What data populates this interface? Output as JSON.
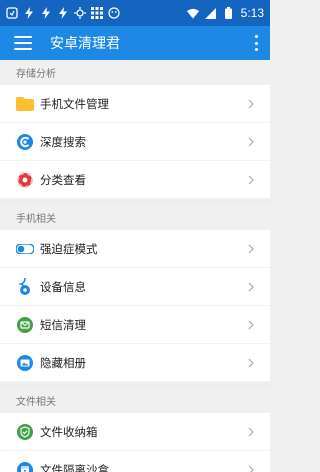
{
  "status_bar": {
    "time": "5:13",
    "icons": [
      "notification-icon",
      "lightning-icon",
      "lightning-icon",
      "lightning-icon",
      "usb-settings-icon",
      "apps-grid-icon",
      "game-icon",
      "wifi-icon",
      "signal-icon",
      "battery-icon"
    ]
  },
  "app_bar": {
    "title": "安卓清理君"
  },
  "sections": [
    {
      "header": "存储分析",
      "items": [
        {
          "label": "手机文件管理",
          "icon": "folder-icon"
        },
        {
          "label": "深度搜索",
          "icon": "deep-search-icon"
        },
        {
          "label": "分类查看",
          "icon": "category-icon"
        }
      ]
    },
    {
      "header": "手机相关",
      "items": [
        {
          "label": "强迫症模式",
          "icon": "toggle-icon"
        },
        {
          "label": "设备信息",
          "icon": "device-info-icon"
        },
        {
          "label": "短信清理",
          "icon": "sms-icon"
        },
        {
          "label": "隐藏相册",
          "icon": "album-icon"
        }
      ]
    },
    {
      "header": "文件相关",
      "items": [
        {
          "label": "文件收纳箱",
          "icon": "shield-check-icon"
        },
        {
          "label": "文件隔离沙盒",
          "icon": "sandbox-icon"
        }
      ]
    }
  ],
  "colors": {
    "status_bar": "#1565c0",
    "app_bar": "#1e88e5",
    "folder": "#fbc02d",
    "deep_search": "#1e88e5",
    "category": "#e53935",
    "toggle": "#1e88e5",
    "device_info": "#1e88e5",
    "sms": "#43a047",
    "album": "#1e88e5",
    "shield": "#43a047",
    "sandbox": "#1e88e5"
  }
}
